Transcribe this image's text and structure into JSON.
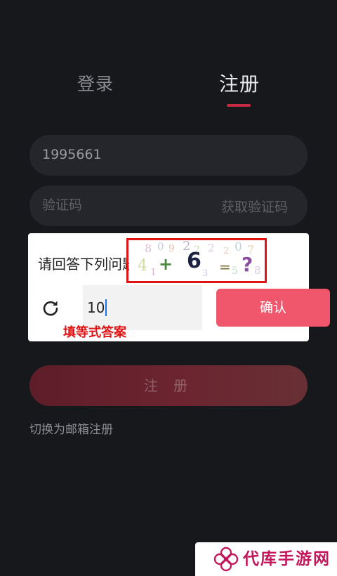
{
  "tabs": {
    "login": "登录",
    "register": "注册"
  },
  "form": {
    "phone_value": "1995661",
    "code_placeholder": "验证码",
    "get_code_label": "获取验证码",
    "register_button": "注 册",
    "switch_link": "切换为邮箱注册"
  },
  "captcha_dialog": {
    "question": "请回答下列问题",
    "captcha_digit": "6",
    "answer_value": "10",
    "confirm_label": "确认",
    "refresh_icon": "refresh-icon"
  },
  "annotation": {
    "hint": "填等式答案",
    "color": "#e01414"
  },
  "watermark": {
    "text": "代库手游网"
  },
  "colors": {
    "background": "#17181c",
    "accent": "#c5283f",
    "confirm": "#f0566c"
  }
}
